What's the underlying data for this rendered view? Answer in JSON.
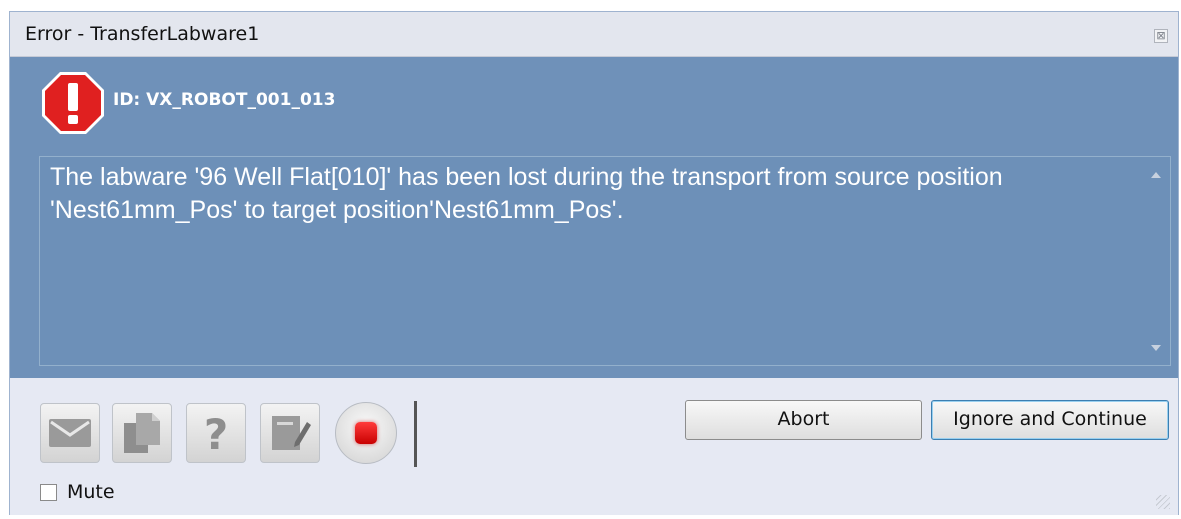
{
  "window": {
    "title": "Error - TransferLabware1",
    "close_glyph": "⊠"
  },
  "error": {
    "id_text": "ID: VX_ROBOT_001_013",
    "icon": "stop-sign-exclamation-icon",
    "message": "The labware '96 Well Flat[010]' has been lost during the transport from source position 'Nest61mm_Pos' to target position'Nest61mm_Pos'."
  },
  "toolbar": {
    "icons": [
      "email-icon",
      "copy-icon",
      "help-icon",
      "notes-icon",
      "stop-icon"
    ]
  },
  "buttons": {
    "abort_label": "Abort",
    "ignore_label": "Ignore and Continue"
  },
  "mute": {
    "label": "Mute",
    "checked": false
  },
  "colors": {
    "panel_blue": "#6f91b9",
    "stop_red": "#e02020",
    "bottom_bg": "#e6e9f3"
  }
}
